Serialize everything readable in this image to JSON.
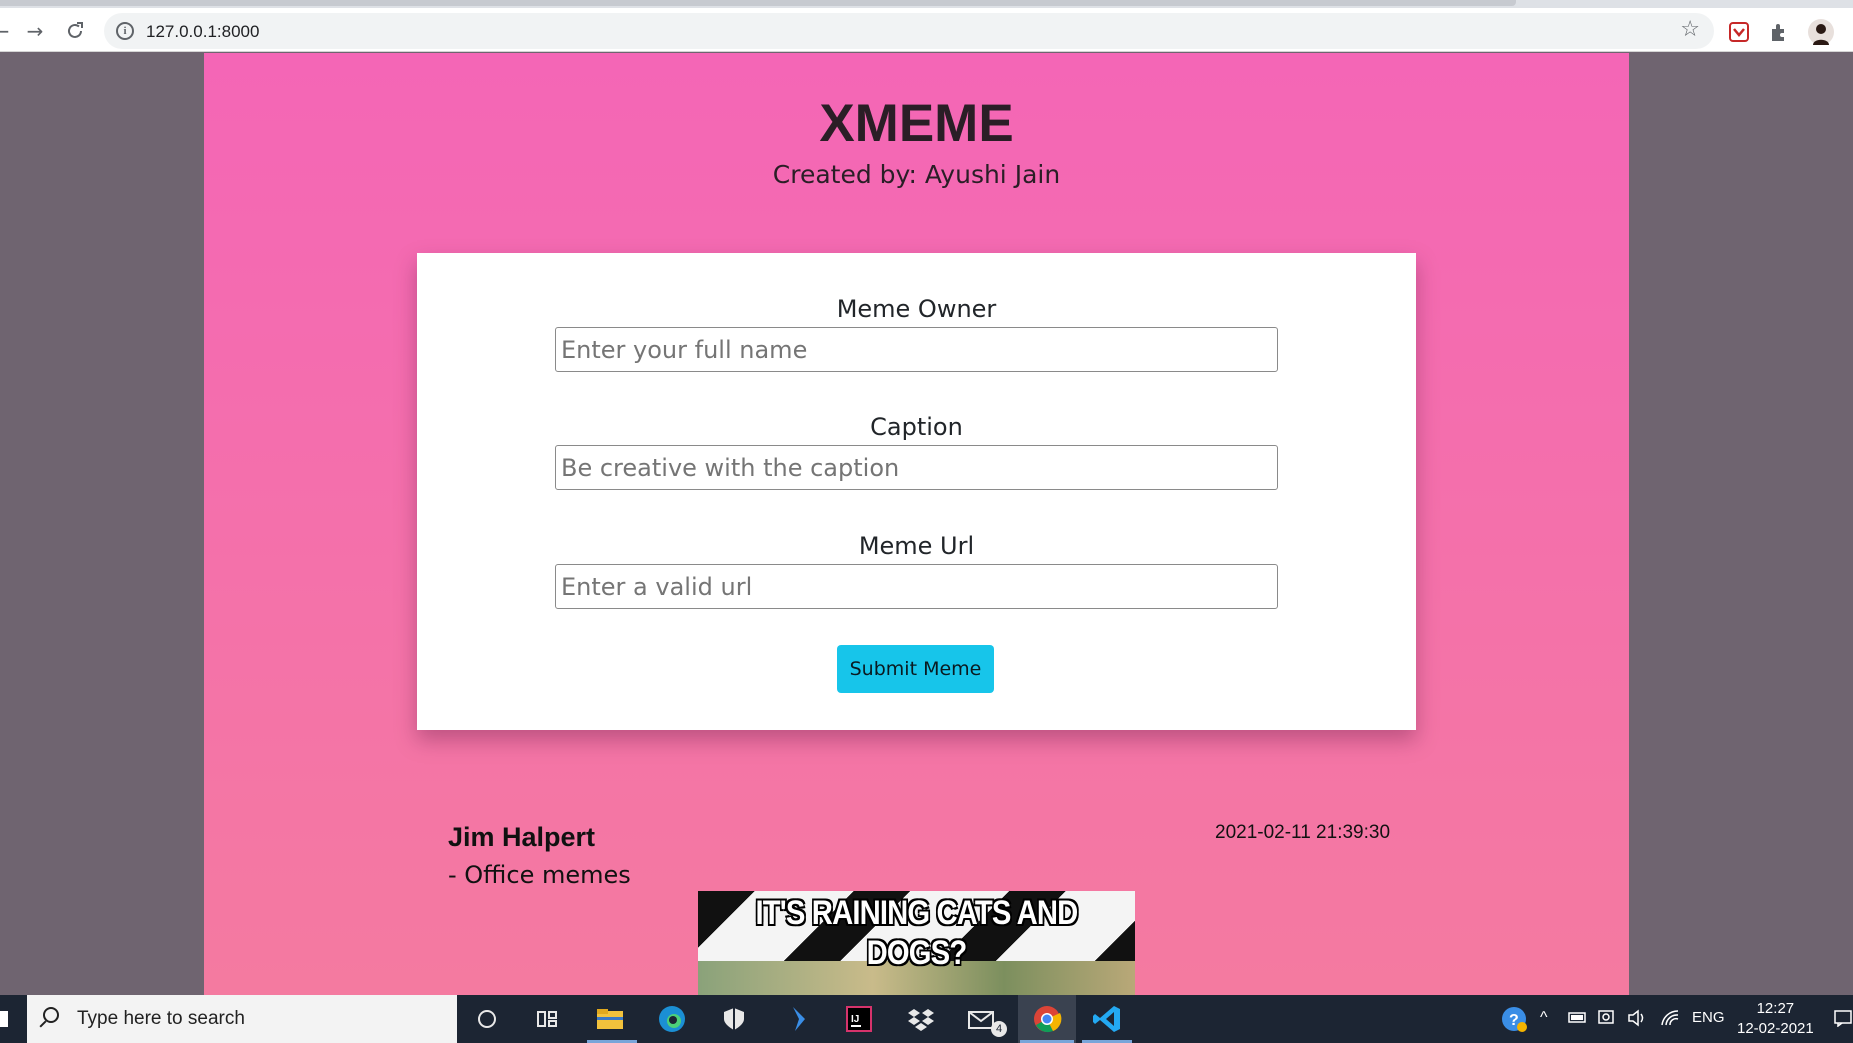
{
  "browser": {
    "url": "127.0.0.1:8000",
    "icons": [
      "back-arrow",
      "forward-arrow",
      "reload",
      "info",
      "bookmark-star",
      "extension-shield",
      "puzzle",
      "profile-avatar"
    ]
  },
  "header": {
    "title": "XMEME",
    "subtitle": "Created by: Ayushi Jain"
  },
  "form": {
    "owner_label": "Meme Owner",
    "owner_placeholder": "Enter your full name",
    "owner_value": "",
    "caption_label": "Caption",
    "caption_placeholder": "Be creative with the caption",
    "caption_value": "",
    "url_label": "Meme Url",
    "url_placeholder": "Enter a valid url",
    "url_value": "",
    "submit_label": "Submit Meme"
  },
  "memes": [
    {
      "owner": "Jim Halpert",
      "caption": "- Office memes",
      "timestamp": "2021-02-11 21:39:30",
      "image_text": "IT'S RAINING CATS AND DOGS?"
    }
  ],
  "taskbar": {
    "search_placeholder": "Type here to search",
    "mail_badge": "4",
    "language": "ENG",
    "time": "12:27",
    "date": "12-02-2021"
  },
  "colors": {
    "page_gradient_top": "#f466b6",
    "page_gradient_bottom": "#f47aa0",
    "button": "#17c5ea",
    "side_background": "#6f6470",
    "taskbar": "#1c2533"
  }
}
